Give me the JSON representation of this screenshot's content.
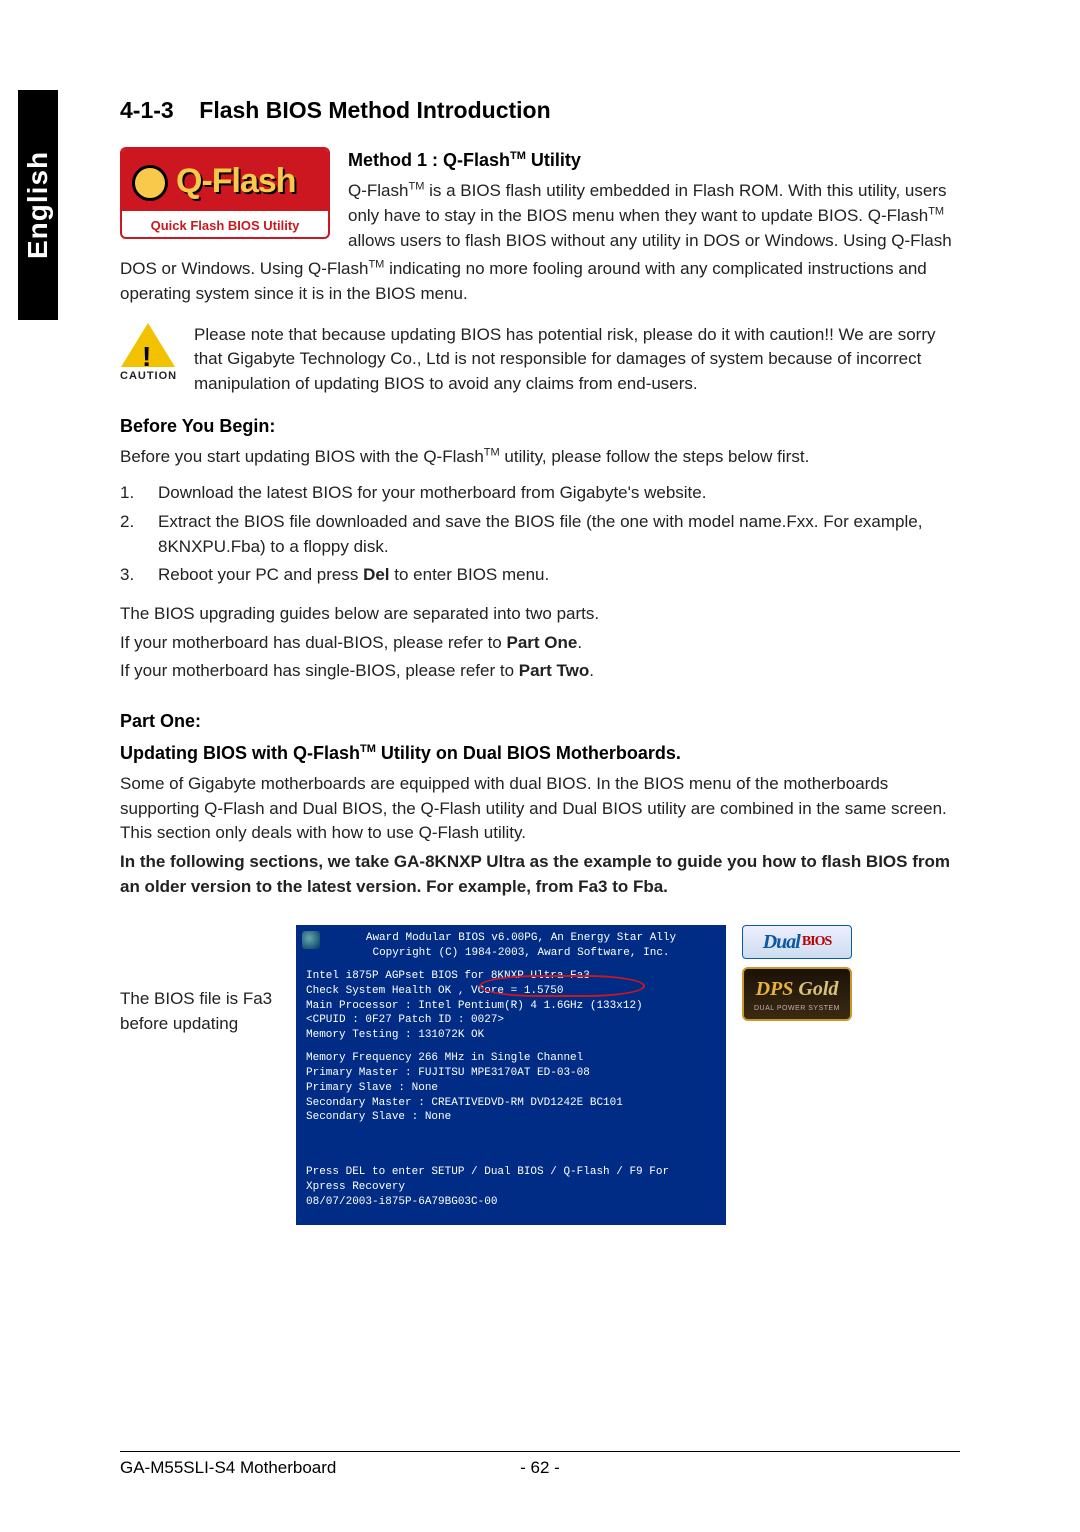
{
  "lang_tab": "English",
  "section_number": "4-1-3",
  "section_title": "Flash BIOS Method Introduction",
  "qflash_logo": {
    "main": "Q-Flash",
    "sub": "Quick Flash BIOS Utility"
  },
  "method1": {
    "title": "Method 1 : Q-Flash",
    "title_tm": "TM",
    "title_tail": " Utility",
    "intro_line1_a": "Q-Flash",
    "intro_line1_b": " is a BIOS flash utility embedded in Flash ROM. With this utility, users only have to stay in the BIOS menu when they want to update BIOS. Q-Flash",
    "intro_line1_c": " allows users to flash BIOS without any utility in DOS or Windows. Using Q-Flash",
    "intro_line1_d": " indicating no more fooling around with any complicated instructions and operating system since it is in the BIOS menu."
  },
  "caution": {
    "label": "CAUTION",
    "text": "Please note that because updating BIOS has potential risk, please do it with caution!! We are sorry that Gigabyte Technology Co., Ltd is not responsible for damages of system because of incorrect manipulation of updating BIOS to avoid any claims from end-users."
  },
  "before": {
    "heading": "Before You Begin:",
    "intro_a": "Before you start updating BIOS with the Q-Flash",
    "intro_b": " utility, please follow the steps below first.",
    "steps": [
      "Download the latest BIOS for your motherboard from Gigabyte's website.",
      "Extract the BIOS file downloaded and save the BIOS file (the one with model name.Fxx. For example, 8KNXPU.Fba) to a floppy disk.",
      "Reboot your PC and press Del to enter BIOS menu."
    ],
    "step3_before": "Reboot your PC and press ",
    "step3_bold": "Del",
    "step3_after": " to enter BIOS menu.",
    "guide1": "The BIOS upgrading guides below are separated into two parts.",
    "guide2_a": "If your motherboard has dual-BIOS, please refer to ",
    "guide2_b": "Part One",
    "guide2_c": ".",
    "guide3_a": "If your motherboard has single-BIOS, please refer to ",
    "guide3_b": "Part Two",
    "guide3_c": "."
  },
  "part_one": {
    "heading": "Part One:",
    "subtitle_a": "Updating BIOS with Q-Flash",
    "subtitle_tm": "TM",
    "subtitle_b": " Utility on Dual BIOS Motherboards.",
    "body": "Some of Gigabyte motherboards are equipped with dual BIOS. In the BIOS menu of the motherboards supporting Q-Flash and Dual BIOS, the Q-Flash utility and Dual BIOS utility are combined in the same screen. This section only deals with how to use Q-Flash utility.",
    "bold_note": "In the following sections, we take GA-8KNXP Ultra as the example to guide you how to flash BIOS from an older version to the latest version. For example, from Fa3 to Fba."
  },
  "bios_note": "The BIOS file is Fa3 before updating",
  "bios_screen": {
    "hdr1": "Award Modular BIOS v6.00PG, An Energy Star Ally",
    "hdr2": "Copyright (C) 1984-2003, Award Software, Inc.",
    "l1": "Intel i875P AGPset BIOS for 8KNXP Ultra Fa3",
    "l2": "Check System Health OK , VCore = 1.5750",
    "l3": "Main Processor : Intel Pentium(R) 4  1.6GHz (133x12)",
    "l4": "<CPUID : 0F27 Patch ID  : 0027>",
    "l5": "Memory Testing  : 131072K OK",
    "l6": "Memory Frequency 266 MHz in Single Channel",
    "l7": "Primary Master : FUJITSU MPE3170AT ED-03-08",
    "l8": "Primary Slave : None",
    "l9": "Secondary Master :  CREATIVEDVD-RM DVD1242E BC101",
    "l10": "Secondary Slave : None",
    "f1": "Press DEL to enter SETUP / Dual BIOS / Q-Flash / F9 For",
    "f2": "Xpress Recovery",
    "f3": "08/07/2003-i875P-6A79BG03C-00"
  },
  "badges": {
    "dual_a": "Dual",
    "dual_b": "BIOS",
    "dps_a": "DPS",
    "dps_b": "Gold",
    "dps_sub": "DUAL POWER SYSTEM"
  },
  "footer": {
    "left": "GA-M55SLI-S4 Motherboard",
    "center": "- 62 -"
  }
}
